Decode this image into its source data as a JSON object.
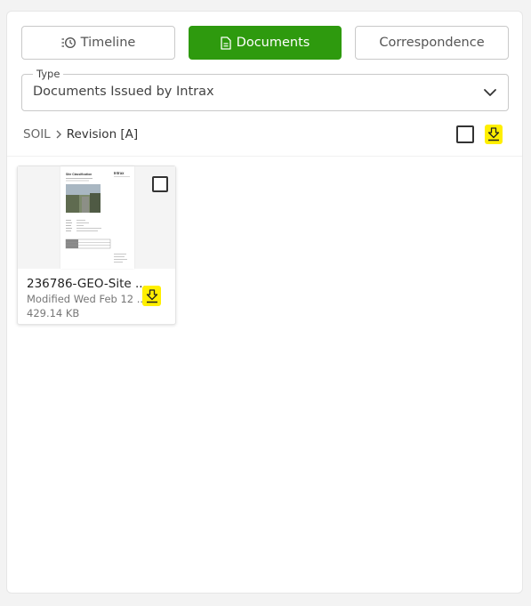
{
  "tabs": {
    "timeline": "Timeline",
    "documents": "Documents",
    "correspondence": "Correspondence"
  },
  "type_filter": {
    "legend": "Type",
    "value": "Documents Issued by Intrax"
  },
  "breadcrumb": {
    "root": "SOIL",
    "current": "Revision [A]"
  },
  "accent_color": "#2e9a0e",
  "highlight_color": "#ffef00",
  "documents": [
    {
      "name": "236786-GEO-Site ...",
      "modified": "Modified Wed Feb 12 ...",
      "size": "429.14 KB",
      "thumbnail": {
        "title": "Site Classification",
        "brand": "Intrax"
      }
    }
  ]
}
